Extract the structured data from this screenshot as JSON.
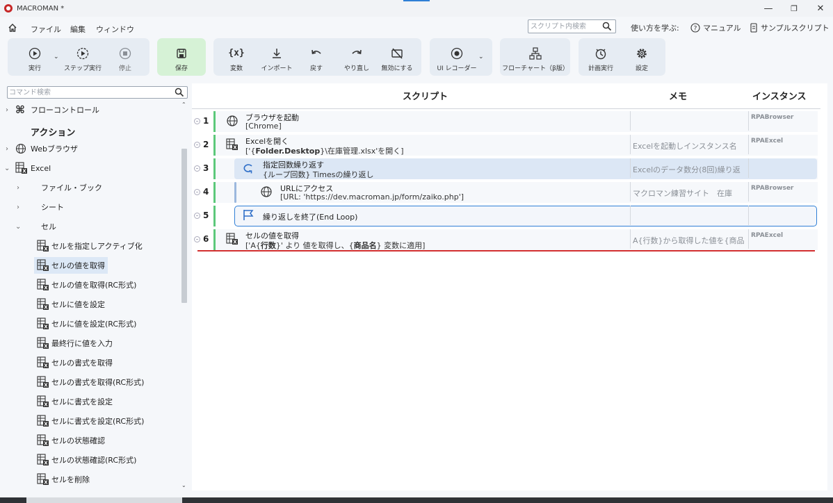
{
  "window": {
    "title": "MACROMAN *",
    "minimize": "—",
    "maximize": "❐",
    "close": "✕"
  },
  "menu": {
    "items": [
      "ファイル",
      "編集",
      "ウィンドウ"
    ],
    "script_search_placeholder": "スクリプト内検索",
    "learn": "使い方を学ぶ:",
    "manual": "マニュアル",
    "sample": "サンプルスクリプト"
  },
  "toolbar": {
    "run": "実行",
    "step_run": "ステップ実行",
    "stop": "停止",
    "save": "保存",
    "variable": "変数",
    "variable_glyph": "{x}",
    "import": "インポート",
    "undo": "戻す",
    "redo": "やり直し",
    "disable": "無効にする",
    "ui_recorder": "UI レコーダー",
    "flowchart": "フローチャート（β版）",
    "schedule": "計画実行",
    "settings": "設定"
  },
  "sidebar": {
    "search_placeholder": "コマンド検索",
    "flow_control": "フローコントロール",
    "actions_heading": "アクション",
    "web_browser": "Webブラウザ",
    "excel": "Excel",
    "file_book": "ファイル・ブック",
    "sheet": "シート",
    "cell": "セル",
    "leaves": [
      "セルを指定しアクティブ化",
      "セルの値を取得",
      "セルの値を取得(RC形式)",
      "セルに値を設定",
      "セルに値を設定(RC形式)",
      "最終行に値を入力",
      "セルの書式を取得",
      "セルの書式を取得(RC形式)",
      "セルに書式を設定",
      "セルに書式を設定(RC形式)",
      "セルの状態確認",
      "セルの状態確認(RC形式)",
      "セルを削除"
    ],
    "selected_index": 1
  },
  "columns": {
    "script": "スクリプト",
    "memo": "メモ",
    "instance": "インスタンス"
  },
  "rows": [
    {
      "num": "1",
      "title": "ブラウザを起動",
      "param": "[Chrome]",
      "memo": "",
      "instance": "RPABrowser"
    },
    {
      "num": "2",
      "title": "Excelを開く",
      "param_pre": "['{",
      "param_bold": "Folder.Desktop",
      "param_post": "}\\在庫管理.xlsx'を開く]",
      "memo": "Excelを起動しインスタンス名",
      "instance": "RPAExcel"
    },
    {
      "num": "3",
      "title": "指定回数繰り返す",
      "param": "{ループ回数} Timesの繰り返し",
      "memo": "Excelのデータ数分(8回)繰り返",
      "instance": ""
    },
    {
      "num": "4",
      "title": "URLにアクセス",
      "param": "[URL: 'https://dev.macroman.jp/form/zaiko.php']",
      "memo": "マクロマン練習サイト　在庫",
      "instance": "RPABrowser"
    },
    {
      "num": "5",
      "title": "繰り返しを終了(End Loop)",
      "memo": "",
      "instance": ""
    },
    {
      "num": "6",
      "title": "セルの値を取得",
      "param_a": "['A{",
      "param_b": "行数",
      "param_c": "}' より 値を取得し、{",
      "param_d": "商品名",
      "param_e": "} 変数に適用]",
      "memo": "A{行数}から取得した値を{商品",
      "instance": "RPAExcel"
    }
  ]
}
